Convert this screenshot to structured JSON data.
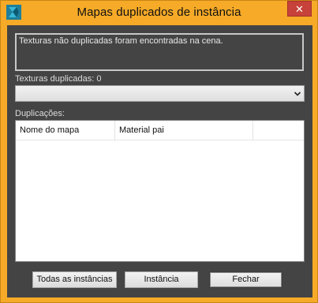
{
  "window": {
    "title": "Mapas duplicados de instância",
    "close_glyph": "✕",
    "app_icon": "3ds-max-icon"
  },
  "info": {
    "text": "Texturas não duplicadas foram encontradas na cena."
  },
  "duplicates_dropdown": {
    "label": "Texturas duplicadas: 0",
    "selected_value": ""
  },
  "duplications": {
    "label": "Duplicações:",
    "columns": [
      "Nome do mapa",
      "Material pai"
    ],
    "rows": []
  },
  "buttons": {
    "instance_all": "Todas as instâncias",
    "instance": "Instância",
    "close": "Fechar"
  },
  "colors": {
    "frame": "#f6aa27",
    "client_bg": "#444444",
    "close_button": "#c7423a"
  }
}
